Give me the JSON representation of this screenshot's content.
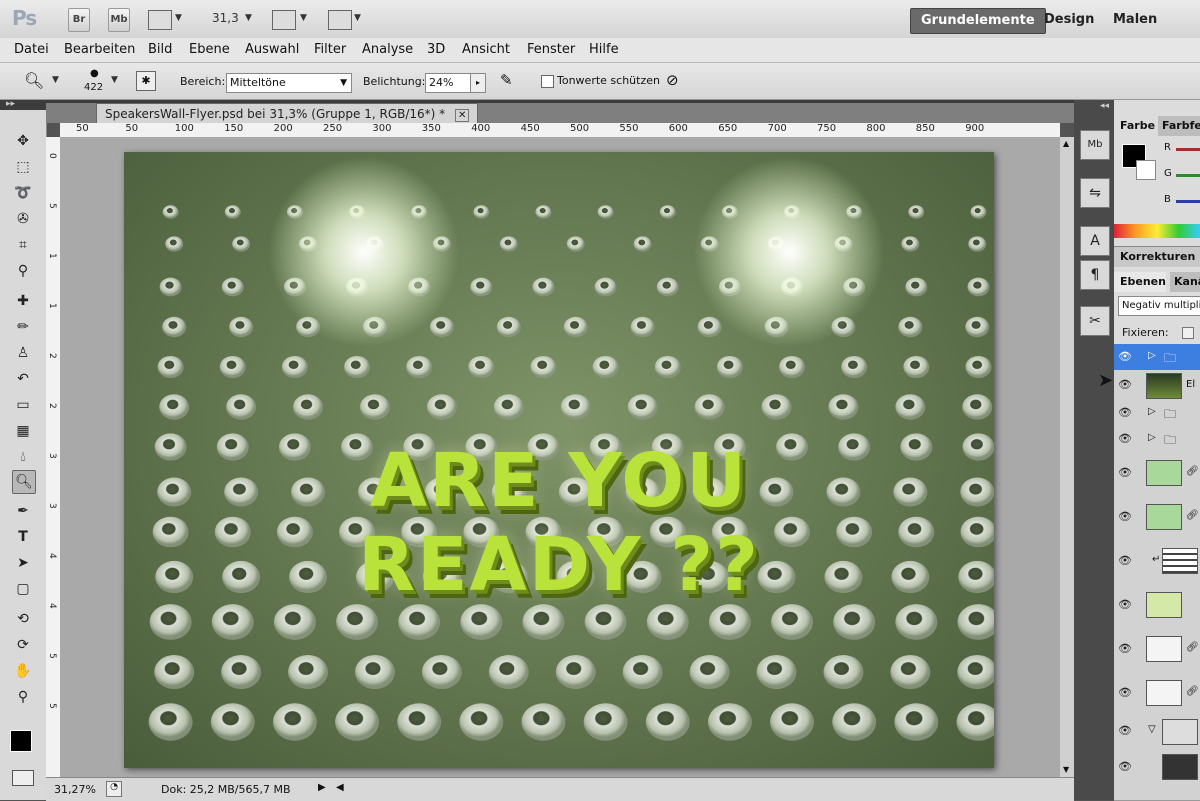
{
  "appbar": {
    "logo": "Ps",
    "br_label": "Br",
    "mb_label": "Mb",
    "zoom": "31,3",
    "workspaces": [
      "Grundelemente",
      "Design",
      "Malen"
    ]
  },
  "menu": [
    "Datei",
    "Bearbeiten",
    "Bild",
    "Ebene",
    "Auswahl",
    "Filter",
    "Analyse",
    "3D",
    "Ansicht",
    "Fenster",
    "Hilfe"
  ],
  "options": {
    "brush_size": "422",
    "range_label": "Bereich:",
    "range_value": "Mitteltöne",
    "exposure_label": "Belichtung:",
    "exposure_value": "24%",
    "protect_label": "Tonwerte schützen"
  },
  "document": {
    "tab_title": "SpeakersWall-Flyer.psd bei 31,3% (Gruppe 1, RGB/16*) *",
    "close_symbol": "✕",
    "ruler_ticks": [
      "50",
      "50",
      "100",
      "150",
      "200",
      "250",
      "300",
      "350",
      "400",
      "450",
      "500",
      "550",
      "600",
      "650",
      "700",
      "750",
      "800",
      "850",
      "900"
    ],
    "ruler_v_ticks": [
      "0",
      "5",
      "1",
      "1",
      "2",
      "2",
      "3",
      "3",
      "4",
      "4",
      "5",
      "5"
    ],
    "artwork_line1": "ARE YOU",
    "artwork_line2": "READY ??"
  },
  "status": {
    "zoom": "31,27%",
    "doc": "Dok: 25,2 MB/565,7 MB"
  },
  "panels": {
    "color_tab": "Farbe",
    "swatches_tab": "Farbfel",
    "r": "R",
    "g": "G",
    "b": "B",
    "corrections_tab": "Korrekturen",
    "layers_tab": "Ebenen",
    "channels_tab": "Kanä",
    "blend_mode": "Negativ multipli",
    "lock_label": "Fixieren:",
    "layer_text_el": "El"
  },
  "colors": {
    "accent_active_layer": "#3c7fe0",
    "title_green": "#b9e23a"
  }
}
